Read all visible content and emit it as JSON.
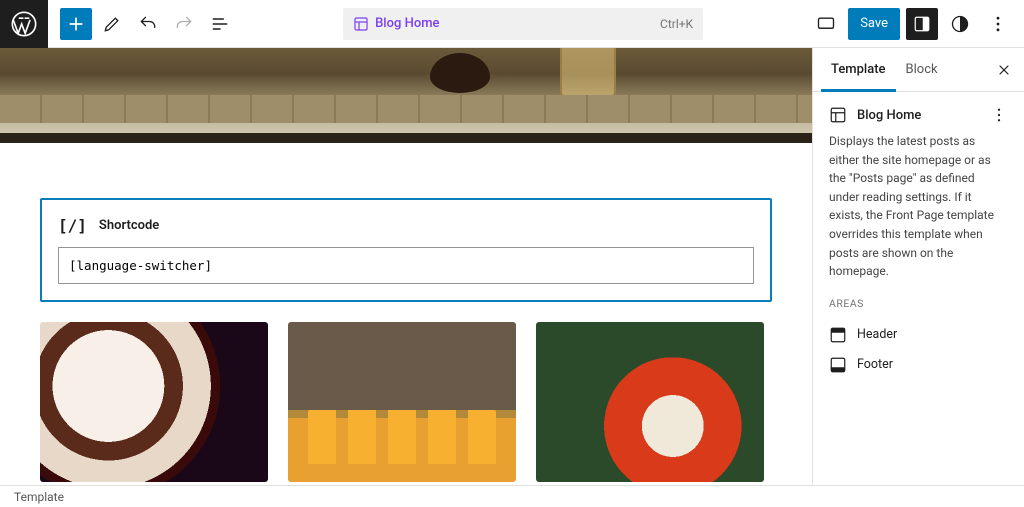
{
  "header": {
    "doc_title": "Blog Home",
    "shortcut": "Ctrl+K",
    "save_label": "Save"
  },
  "block": {
    "title": "Shortcode",
    "value": "[language-switcher]"
  },
  "sidebar": {
    "tabs": {
      "template": "Template",
      "block": "Block"
    },
    "panel": {
      "title": "Blog Home",
      "description": "Displays the latest posts as either the site homepage or as the \"Posts page\" as defined under reading settings. If it exists, the Front Page template overrides this template when posts are shown on the homepage.",
      "areas_label": "AREAS",
      "areas": {
        "header": "Header",
        "footer": "Footer"
      }
    }
  },
  "footer": {
    "breadcrumb": "Template"
  }
}
